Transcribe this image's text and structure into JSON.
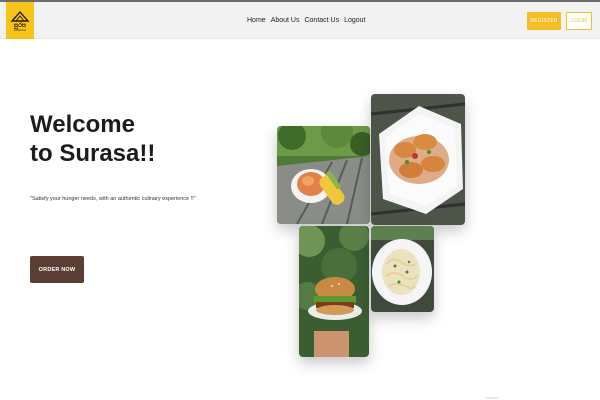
{
  "header": {
    "logo": {
      "brand_script": "සුරස",
      "brand_sub": "SURASA"
    },
    "nav": [
      {
        "label": "Home"
      },
      {
        "label": "About Us"
      },
      {
        "label": "Contact Us"
      },
      {
        "label": "Logout"
      }
    ],
    "register_label": "REGISTER",
    "login_label": "LOGIN"
  },
  "hero": {
    "title_line1": "Welcome",
    "title_line2": "to Surasa!!",
    "tagline": "\"Satisfy your hunger needs, with an authentic culinary experience !!\"",
    "order_label": "ORDER NOW"
  },
  "gallery": [
    {
      "subject": "corn-and-carrot-plate"
    },
    {
      "subject": "fried-patties-plate"
    },
    {
      "subject": "burger-in-hand"
    },
    {
      "subject": "pasta-plate"
    }
  ],
  "colors": {
    "accent_yellow": "#f3be28",
    "order_button": "#5b3f34",
    "header_bg": "#f2f2f2"
  }
}
